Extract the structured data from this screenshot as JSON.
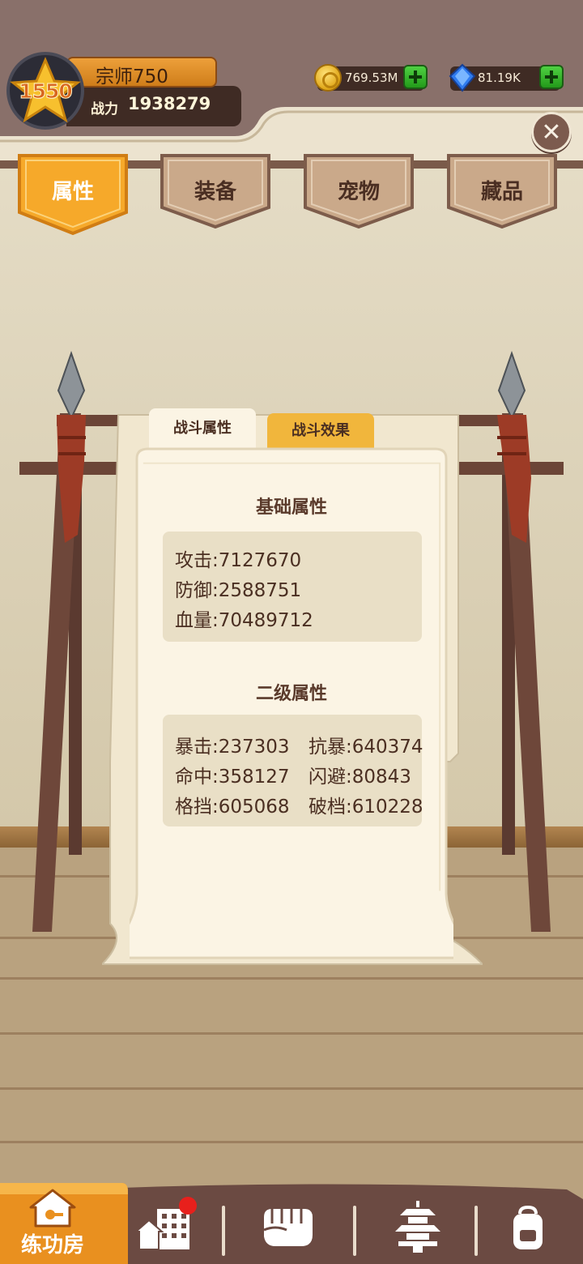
{
  "player": {
    "level": "1550",
    "rank_title": "宗师750",
    "power_label": "战力",
    "power_value": "1938279"
  },
  "currencies": {
    "gold": "769.53M",
    "gems": "81.19K"
  },
  "top_tabs": [
    {
      "label": "属性",
      "active": true
    },
    {
      "label": "装备",
      "active": false
    },
    {
      "label": "宠物",
      "active": false
    },
    {
      "label": "藏品",
      "active": false
    }
  ],
  "sub_tabs": [
    {
      "label": "战斗属性",
      "active": true
    },
    {
      "label": "战斗效果",
      "active": false
    }
  ],
  "basic": {
    "title": "基础属性",
    "attack": "攻击:7127670",
    "defense": "防御:2588751",
    "hp": "血量:70489712"
  },
  "secondary": {
    "title": "二级属性",
    "crit": "暴击:237303",
    "crit_resist": "抗暴:640374",
    "hit": "命中:358127",
    "dodge": "闪避:80843",
    "block": "格挡:605068",
    "break_block": "破档:610228"
  },
  "bottom_nav": {
    "home_label": "练功房",
    "icons": [
      "home-icon",
      "buildings-icon",
      "fist-icon",
      "pagoda-icon",
      "backpack-icon"
    ]
  },
  "colors": {
    "accent_orange": "#f4a526",
    "header_brown": "#89706a",
    "text_brown": "#4b2f22",
    "paper": "#fbf4e4"
  }
}
